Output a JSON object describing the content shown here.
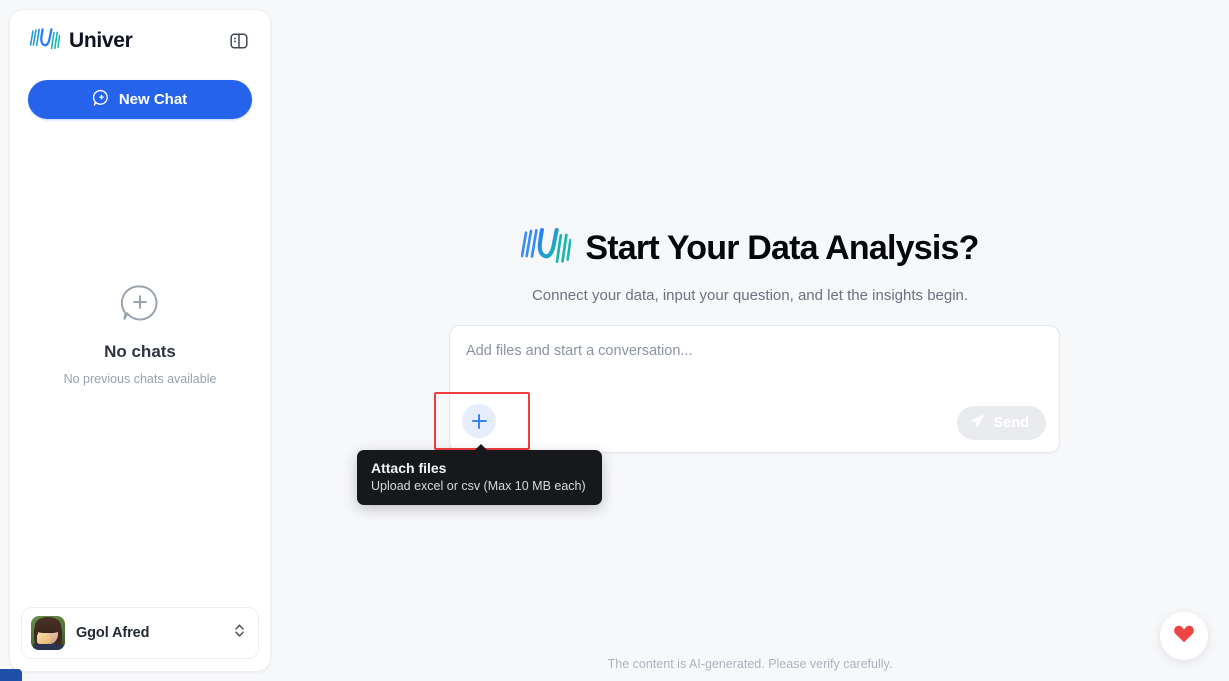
{
  "app": {
    "brand_name": "Univer"
  },
  "sidebar": {
    "toggle_icon": "panel-toggle-icon",
    "new_chat_label": "New Chat",
    "new_chat_icon": "chat-plus-icon",
    "empty_state": {
      "icon": "chat-plus-circle-icon",
      "title": "No chats",
      "subtitle": "No previous chats available"
    },
    "user": {
      "name": "Ggol Afred",
      "avatar_alt": "user-avatar-photo",
      "selector_icon": "chevron-up-down-icon"
    }
  },
  "main": {
    "hero_logo": "univer-logo-icon",
    "hero_title": "Start Your Data Analysis?",
    "hero_subtitle": "Connect your data, input your question, and let the insights begin.",
    "composer": {
      "placeholder": "Add files and start a conversation...",
      "value": "",
      "attach_icon": "plus-icon",
      "send_label": "Send",
      "send_icon": "paper-plane-icon",
      "send_disabled": true
    },
    "tooltip": {
      "title": "Attach files",
      "subtitle": "Upload excel or csv (Max 10 MB each)"
    },
    "footer_note": "The content is AI-generated. Please verify carefully.",
    "fab": {
      "icon": "heart-icon"
    }
  },
  "colors": {
    "accent_blue": "#2563eb",
    "attach_blue": "#3b82f6",
    "highlight_red": "#f03e3e",
    "heart_red": "#ef4444",
    "tooltip_bg": "#17181c",
    "page_bg": "#f7f8fa"
  }
}
